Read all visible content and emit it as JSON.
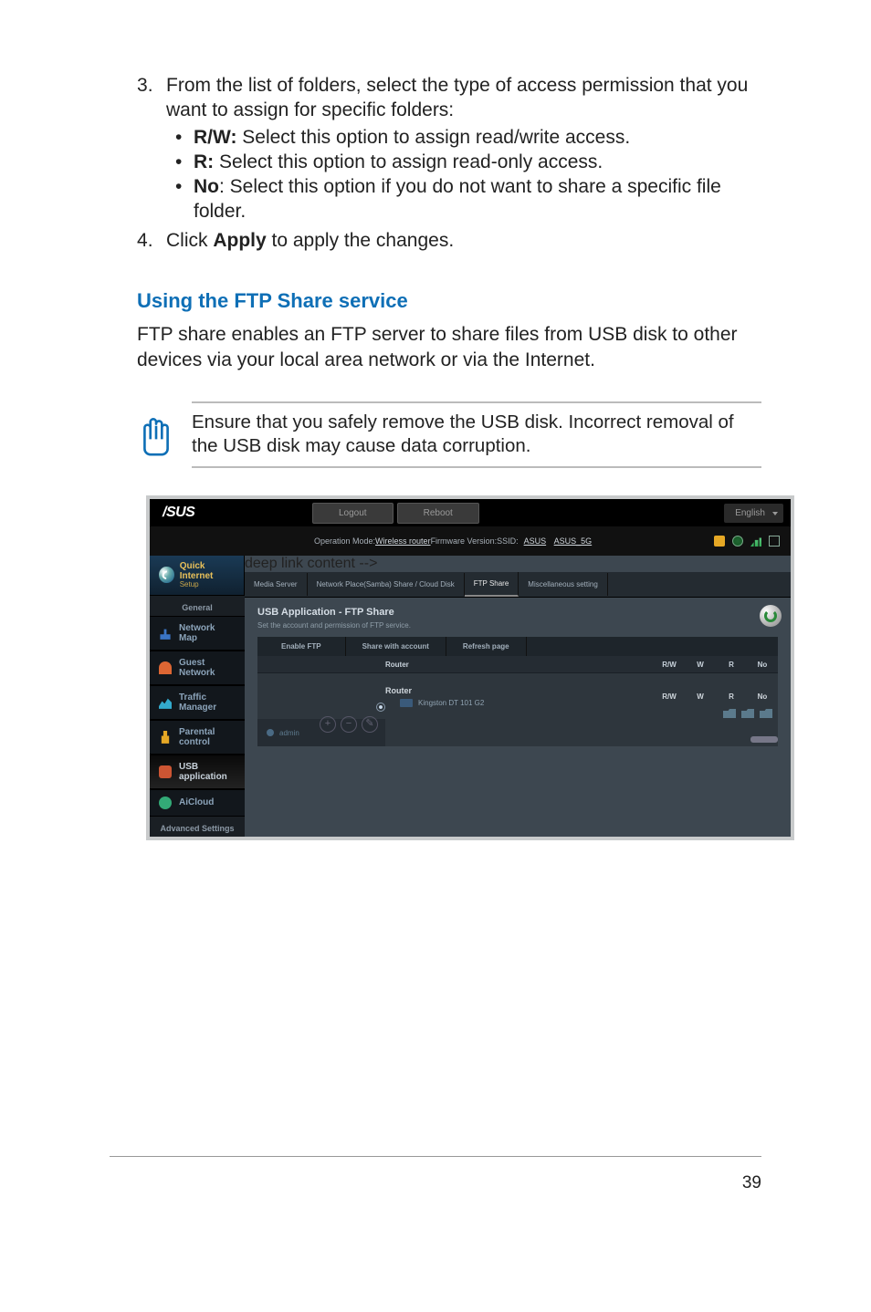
{
  "step3": {
    "text_a": "From the list of folders, select the type of access permission that you want to assign for specific folders:",
    "b1_label": "R/W:",
    "b1_text": "Select this option to assign read/write access.",
    "b2_label": "R:",
    "b2_text": "Select this option to assign read-only access.",
    "b3_label": "No",
    "b3_text": "Select this option if you do not want to share a specific file folder."
  },
  "step4": {
    "text_a": "Click ",
    "apply": "Apply",
    "text_b": " to apply the changes."
  },
  "subhead": "Using the FTP Share service",
  "body": "FTP share enables an FTP server to share files from USB disk to other devices via your local area network or via the Internet.",
  "note": "Ensure that you safely remove the USB disk. Incorrect removal of the USB disk may cause data corruption.",
  "router": {
    "logo": "/SUS",
    "logout": "Logout",
    "reboot": "Reboot",
    "lang": "English",
    "opmode_label": "Operation Mode: ",
    "opmode": "Wireless router",
    "fw_label": "   Firmware Version: ",
    "ssid_label": "   SSID: ",
    "ssid1": "ASUS",
    "ssid2": "ASUS_5G",
    "quick": "Quick Internet",
    "quick_sub": "Setup",
    "section": "General",
    "nav1": "Network Map",
    "nav2": "Guest Network",
    "nav3": "Traffic Manager",
    "nav4": "Parental control",
    "nav5": "USB application",
    "nav6": "AiCloud",
    "nav_adv": "Advanced Settings",
    "tab1": "Media Server",
    "tab2": "Network Place(Samba) Share / Cloud Disk",
    "tab3": "FTP Share",
    "tab4": "Miscellaneous setting",
    "panel_title": "USB Application - FTP Share",
    "panel_sub": "Set the account and permission of FTP service.",
    "dt1": "Enable FTP",
    "dt2": "Share with account",
    "dt3": "Refresh page",
    "account": "admin",
    "rhead": "Router",
    "c1": "R/W",
    "c2": "W",
    "c3": "R",
    "c4": "No",
    "drive": "Kingston DT 101 G2"
  },
  "page_num": "39"
}
